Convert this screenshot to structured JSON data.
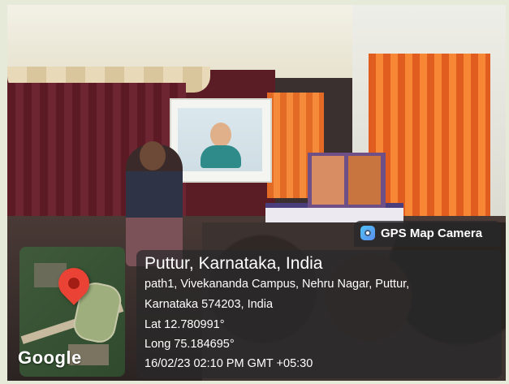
{
  "watermark": {
    "app_name": "GPS Map Camera",
    "location_title": "Puttur, Karnataka, India",
    "address_line_1": "path1, Vivekananda Campus, Nehru Nagar, Puttur,",
    "address_line_2": "Karnataka 574203, India",
    "latitude": "Lat 12.780991°",
    "longitude": "Long 75.184695°",
    "timestamp": "16/02/23 02:10 PM GMT +05:30",
    "map_brand": "Google"
  },
  "colors": {
    "overlay": "#28282a",
    "pin": "#ea4335",
    "text": "#ffffff"
  }
}
